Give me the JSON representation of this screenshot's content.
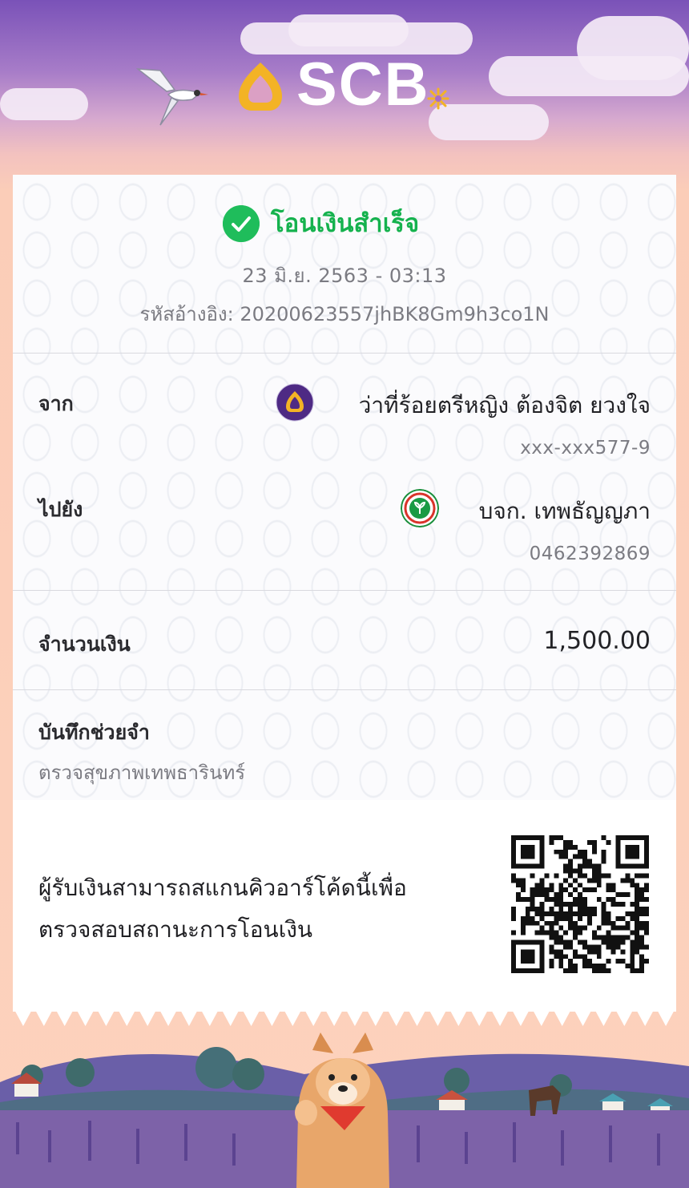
{
  "header": {
    "brand": "SCB",
    "colors": {
      "purple": "#4e2a84",
      "gold": "#f3b325",
      "sky_top": "#7a52b8",
      "peach": "#fdd2bd"
    }
  },
  "receipt": {
    "status": "โอนเงินสำเร็จ",
    "status_color": "#15b24e",
    "datetime": "23 มิ.ย. 2563 - 03:13",
    "reference": "รหัสอ้างอิง: 20200623557jhBK8Gm9h3co1N",
    "from": {
      "label": "จาก",
      "name": "ว่าที่ร้อยตรีหญิง ต้องจิต ยวงใจ",
      "account": "xxx-xxx577-9",
      "bank_icon": "scb-bank-icon"
    },
    "to": {
      "label": "ไปยัง",
      "name": "บจก. เทพธัญญภา",
      "account": "0462392869",
      "bank_icon": "kbank-icon"
    },
    "amount": {
      "label": "จำนวนเงิน",
      "value": "1,500.00"
    },
    "memo": {
      "label": "บันทึกช่วยจำ",
      "value": "ตรวจสุขภาพเทพธารินทร์"
    },
    "qr": {
      "line1": "ผู้รับเงินสามารถสแกนคิวอาร์โค้ดนี้เพื่อ",
      "line2": "ตรวจสอบสถานะการโอนเงิน"
    }
  }
}
